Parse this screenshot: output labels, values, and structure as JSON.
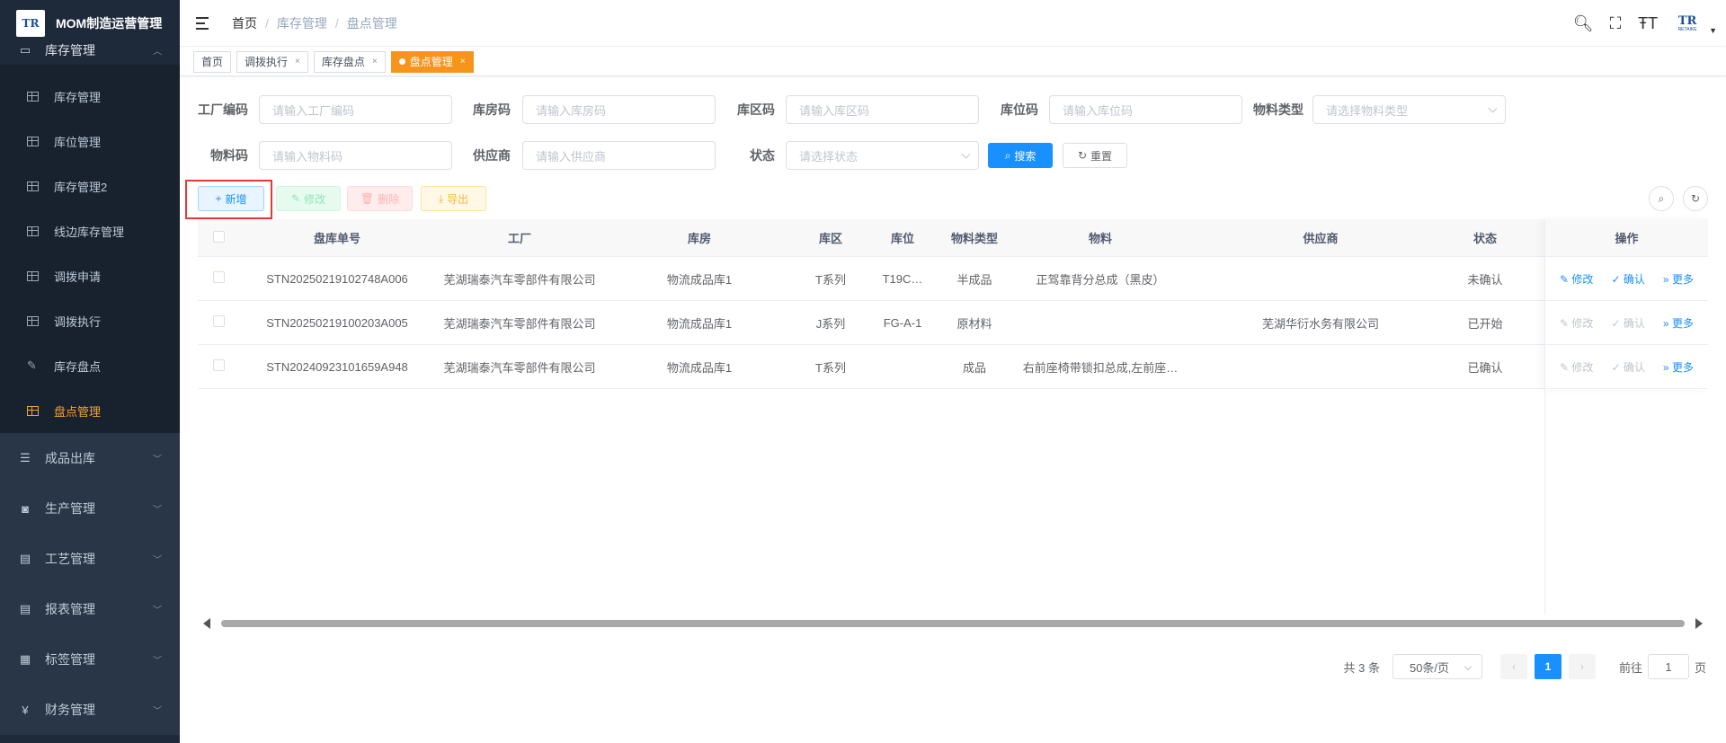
{
  "app": {
    "logo_text": "TR",
    "title": "MOM制造运营管理"
  },
  "sidebar": {
    "top_group": {
      "label": "库存管理",
      "icon": "monitor-icon"
    },
    "sub_items": [
      {
        "label": "库存管理"
      },
      {
        "label": "库位管理"
      },
      {
        "label": "库存管理2"
      },
      {
        "label": "线边库存管理"
      },
      {
        "label": "调拨申请"
      },
      {
        "label": "调拨执行"
      },
      {
        "label": "库存盘点"
      },
      {
        "label": "盘点管理"
      }
    ],
    "groups": [
      {
        "label": "成品出库",
        "icon": "list-icon"
      },
      {
        "label": "生产管理",
        "icon": "production-icon"
      },
      {
        "label": "工艺管理",
        "icon": "process-icon"
      },
      {
        "label": "报表管理",
        "icon": "report-icon"
      },
      {
        "label": "标签管理",
        "icon": "tag-icon"
      },
      {
        "label": "财务管理",
        "icon": "yen-icon",
        "glyph": "¥"
      }
    ]
  },
  "header": {
    "breadcrumb": [
      "首页",
      "库存管理",
      "盘点管理"
    ],
    "avatar_text": "TR",
    "avatar_sub": "RETAIKE"
  },
  "tags": [
    {
      "label": "首页"
    },
    {
      "label": "调拨执行"
    },
    {
      "label": "库存盘点"
    },
    {
      "label": "盘点管理"
    }
  ],
  "filters": {
    "factory_code": {
      "label": "工厂编码",
      "placeholder": "请输入工厂编码"
    },
    "warehouse_code": {
      "label": "库房码",
      "placeholder": "请输入库房码"
    },
    "area_code": {
      "label": "库区码",
      "placeholder": "请输入库区码"
    },
    "location_code": {
      "label": "库位码",
      "placeholder": "请输入库位码"
    },
    "material_type": {
      "label": "物料类型",
      "placeholder": "请选择物料类型"
    },
    "material_code": {
      "label": "物料码",
      "placeholder": "请输入物料码"
    },
    "supplier": {
      "label": "供应商",
      "placeholder": "请输入供应商"
    },
    "status": {
      "label": "状态",
      "placeholder": "请选择状态"
    },
    "search_label": "搜索",
    "reset_label": "重置"
  },
  "toolbar": {
    "add_label": "新增",
    "edit_label": "修改",
    "delete_label": "删除",
    "export_label": "导出"
  },
  "table": {
    "columns": [
      "盘库单号",
      "工厂",
      "库房",
      "库区",
      "库位",
      "物料类型",
      "物料",
      "供应商",
      "状态",
      "操作"
    ],
    "rows": [
      {
        "no": "STN20250219102748A006",
        "factory": "芜湖瑞泰汽车零部件有限公司",
        "warehouse": "物流成品库1",
        "area": "T系列",
        "location": "T19C…",
        "type": "半成品",
        "material": "正驾靠背分总成（黑皮）",
        "supplier": "",
        "status": "未确认",
        "edit": "修改",
        "confirm": "确认",
        "more": "更多"
      },
      {
        "no": "STN20250219100203A005",
        "factory": "芜湖瑞泰汽车零部件有限公司",
        "warehouse": "物流成品库1",
        "area": "J系列",
        "location": "FG-A-1",
        "type": "原材料",
        "material": "",
        "supplier": "芜湖华衍水务有限公司",
        "status": "已开始",
        "edit": "修改",
        "confirm": "确认",
        "more": "更多"
      },
      {
        "no": "STN20240923101659A948",
        "factory": "芜湖瑞泰汽车零部件有限公司",
        "warehouse": "物流成品库1",
        "area": "T系列",
        "location": "",
        "type": "成品",
        "material": "右前座椅带锁扣总成,左前座…",
        "supplier": "",
        "status": "已确认",
        "edit": "修改",
        "confirm": "确认",
        "more": "更多"
      }
    ]
  },
  "pagination": {
    "total_text": "共 3 条",
    "page_size": "50条/页",
    "current_page": "1",
    "goto_prefix": "前往",
    "goto_value": "1",
    "goto_suffix": "页"
  },
  "colors": {
    "accent": "#1890ff",
    "active_tag": "#f7941d",
    "sidebar_bg": "#1e2a3a",
    "active_menu": "#f7a233"
  }
}
